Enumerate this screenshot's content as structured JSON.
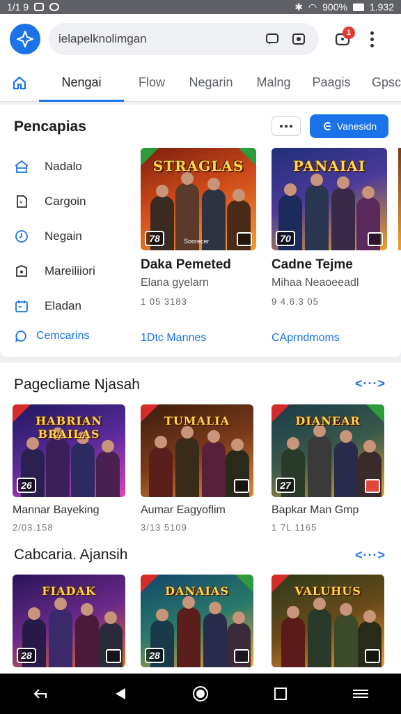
{
  "status_bar": {
    "time": "1/1 9",
    "battery": "900%",
    "clock_right": "1.932"
  },
  "search": {
    "value": "ielapelknolimgan",
    "placeholder": ""
  },
  "notifications": {
    "count": "1"
  },
  "tabs": [
    {
      "label": "Nengai",
      "active": true
    },
    {
      "label": "Flow",
      "active": false
    },
    {
      "label": "Negarin",
      "active": false
    },
    {
      "label": "Malng",
      "active": false
    },
    {
      "label": "Paagis",
      "active": false
    },
    {
      "label": "Gpsc",
      "active": false
    }
  ],
  "top_section": {
    "title": "Pencapias",
    "primary_button": "Vanesidn",
    "side_nav": [
      {
        "label": "Nadalo",
        "icon": "home-outline-icon"
      },
      {
        "label": "Cargoin",
        "icon": "file-icon"
      },
      {
        "label": "Negain",
        "icon": "clock-icon"
      },
      {
        "label": "Mareiliiori",
        "icon": "shield-icon"
      },
      {
        "label": "Eladan",
        "icon": "calendar-icon"
      }
    ],
    "side_link": "Cemcarins",
    "featured": [
      {
        "thumb_title": "STRAGLAS",
        "badge": "78",
        "caption": "Soorecer",
        "name": "Daka Pemeted",
        "subtitle": "Elana gyelarn",
        "meta": "1 05 3183",
        "link": "1Dtc Mannes",
        "palette": [
          "#a33416",
          "#f08b2c"
        ]
      },
      {
        "thumb_title": "PANAIAI",
        "badge": "70",
        "caption": "",
        "name": "Cadne Tejme",
        "subtitle": "Mihaa Neaoeeadl",
        "meta": "9 4.6.3 05",
        "link": "CAprndmoms",
        "palette": [
          "#2b3a8a",
          "#e6a020"
        ]
      }
    ]
  },
  "section2": {
    "title": "Pagecliame Njasah",
    "more": "<···>",
    "items": [
      {
        "thumb_title": "HABRIAN BRAILAS",
        "badge": "26",
        "name": "Mannar Bayeking",
        "meta": "2/03.158",
        "palette": [
          "#2a2370",
          "#c33fb1"
        ]
      },
      {
        "thumb_title": "TUMALIA",
        "badge": "",
        "name": "Aumar Eagyoflim",
        "meta": "3/13 5109",
        "palette": [
          "#5a2b12",
          "#d88b3a"
        ]
      },
      {
        "thumb_title": "DIANEAR",
        "badge": "27",
        "name": "Bapkar Man Gmp",
        "meta": "1 7L 1165",
        "palette": [
          "#1f4a5e",
          "#e4a23a"
        ]
      }
    ]
  },
  "section3": {
    "title": "Cabcaria. Ajansih",
    "more": "<···>",
    "items": [
      {
        "thumb_title": "FIADAK",
        "badge": "28",
        "palette": [
          "#3a1a6a",
          "#e36a2b"
        ]
      },
      {
        "thumb_title": "DANAIAS",
        "badge": "28",
        "palette": [
          "#1b4a6b",
          "#e8a33a"
        ]
      },
      {
        "thumb_title": "VALUHUS",
        "badge": "",
        "palette": [
          "#2d4a2a",
          "#f09a35"
        ]
      }
    ]
  },
  "colors": {
    "accent": "#1a73e8",
    "badge_red": "#e53935"
  }
}
